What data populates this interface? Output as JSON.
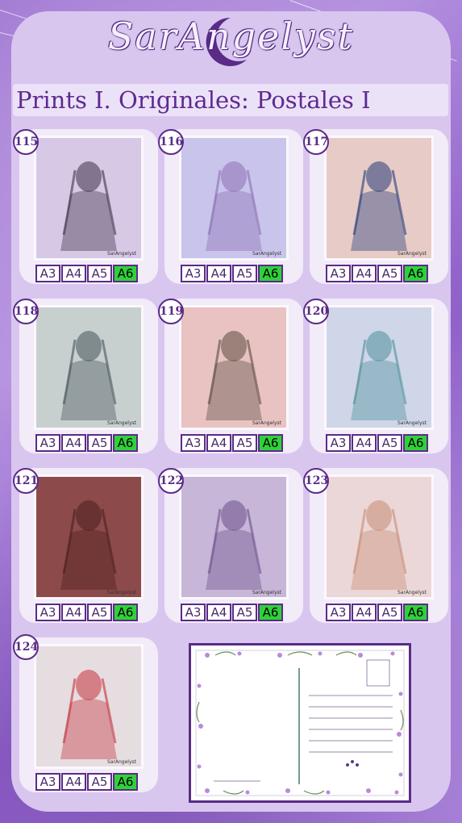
{
  "header": {
    "brand": "SarAngelyst",
    "subtitle": "Prints I. Originales: Postales I"
  },
  "colors": {
    "accent": "#5a2b87",
    "selected_size": "#2fd13a",
    "panel": "#d9c6ef"
  },
  "cards": [
    {
      "number": "115",
      "sizes": [
        "A3",
        "A4",
        "A5",
        "A6"
      ],
      "selected": "A6",
      "signature": "SarAngelyst"
    },
    {
      "number": "116",
      "sizes": [
        "A3",
        "A4",
        "A5",
        "A6"
      ],
      "selected": "A6",
      "signature": "SarAngelyst"
    },
    {
      "number": "117",
      "sizes": [
        "A3",
        "A4",
        "A5",
        "A6"
      ],
      "selected": "A6",
      "signature": "SarAngelyst"
    },
    {
      "number": "118",
      "sizes": [
        "A3",
        "A4",
        "A5",
        "A6"
      ],
      "selected": "A6",
      "signature": "SarAngelyst"
    },
    {
      "number": "119",
      "sizes": [
        "A3",
        "A4",
        "A5",
        "A6"
      ],
      "selected": "A6",
      "signature": "SarAngelyst"
    },
    {
      "number": "120",
      "sizes": [
        "A3",
        "A4",
        "A5",
        "A6"
      ],
      "selected": "A6",
      "signature": "SarAngelyst"
    },
    {
      "number": "121",
      "sizes": [
        "A3",
        "A4",
        "A5",
        "A6"
      ],
      "selected": "A6",
      "signature": "SarAngelyst"
    },
    {
      "number": "122",
      "sizes": [
        "A3",
        "A4",
        "A5",
        "A6"
      ],
      "selected": "A6",
      "signature": "SarAngelyst"
    },
    {
      "number": "123",
      "sizes": [
        "A3",
        "A4",
        "A5",
        "A6"
      ],
      "selected": "A6",
      "signature": "SarAngelyst"
    },
    {
      "number": "124",
      "sizes": [
        "A3",
        "A4",
        "A5",
        "A6"
      ],
      "selected": "A6",
      "signature": "SarAngelyst"
    }
  ],
  "artworks": [
    {
      "bg": "#d7c8e6",
      "fg": "#3c3045"
    },
    {
      "bg": "#c9c4ec",
      "fg": "#8a6fb0"
    },
    {
      "bg": "#e7cbc6",
      "fg": "#243a7a"
    },
    {
      "bg": "#c8d0cf",
      "fg": "#45525a"
    },
    {
      "bg": "#e8c3c1",
      "fg": "#5a4a40"
    },
    {
      "bg": "#cfd6e7",
      "fg": "#4c8f9a"
    },
    {
      "bg": "#8c4a4a",
      "fg": "#4a1f1f"
    },
    {
      "bg": "#c8b6d8",
      "fg": "#6a4f8a"
    },
    {
      "bg": "#ecd7d8",
      "fg": "#c78a72"
    },
    {
      "bg": "#e6dde0",
      "fg": "#c4313a"
    }
  ],
  "postcard": {
    "type": "postcard-back-template"
  }
}
